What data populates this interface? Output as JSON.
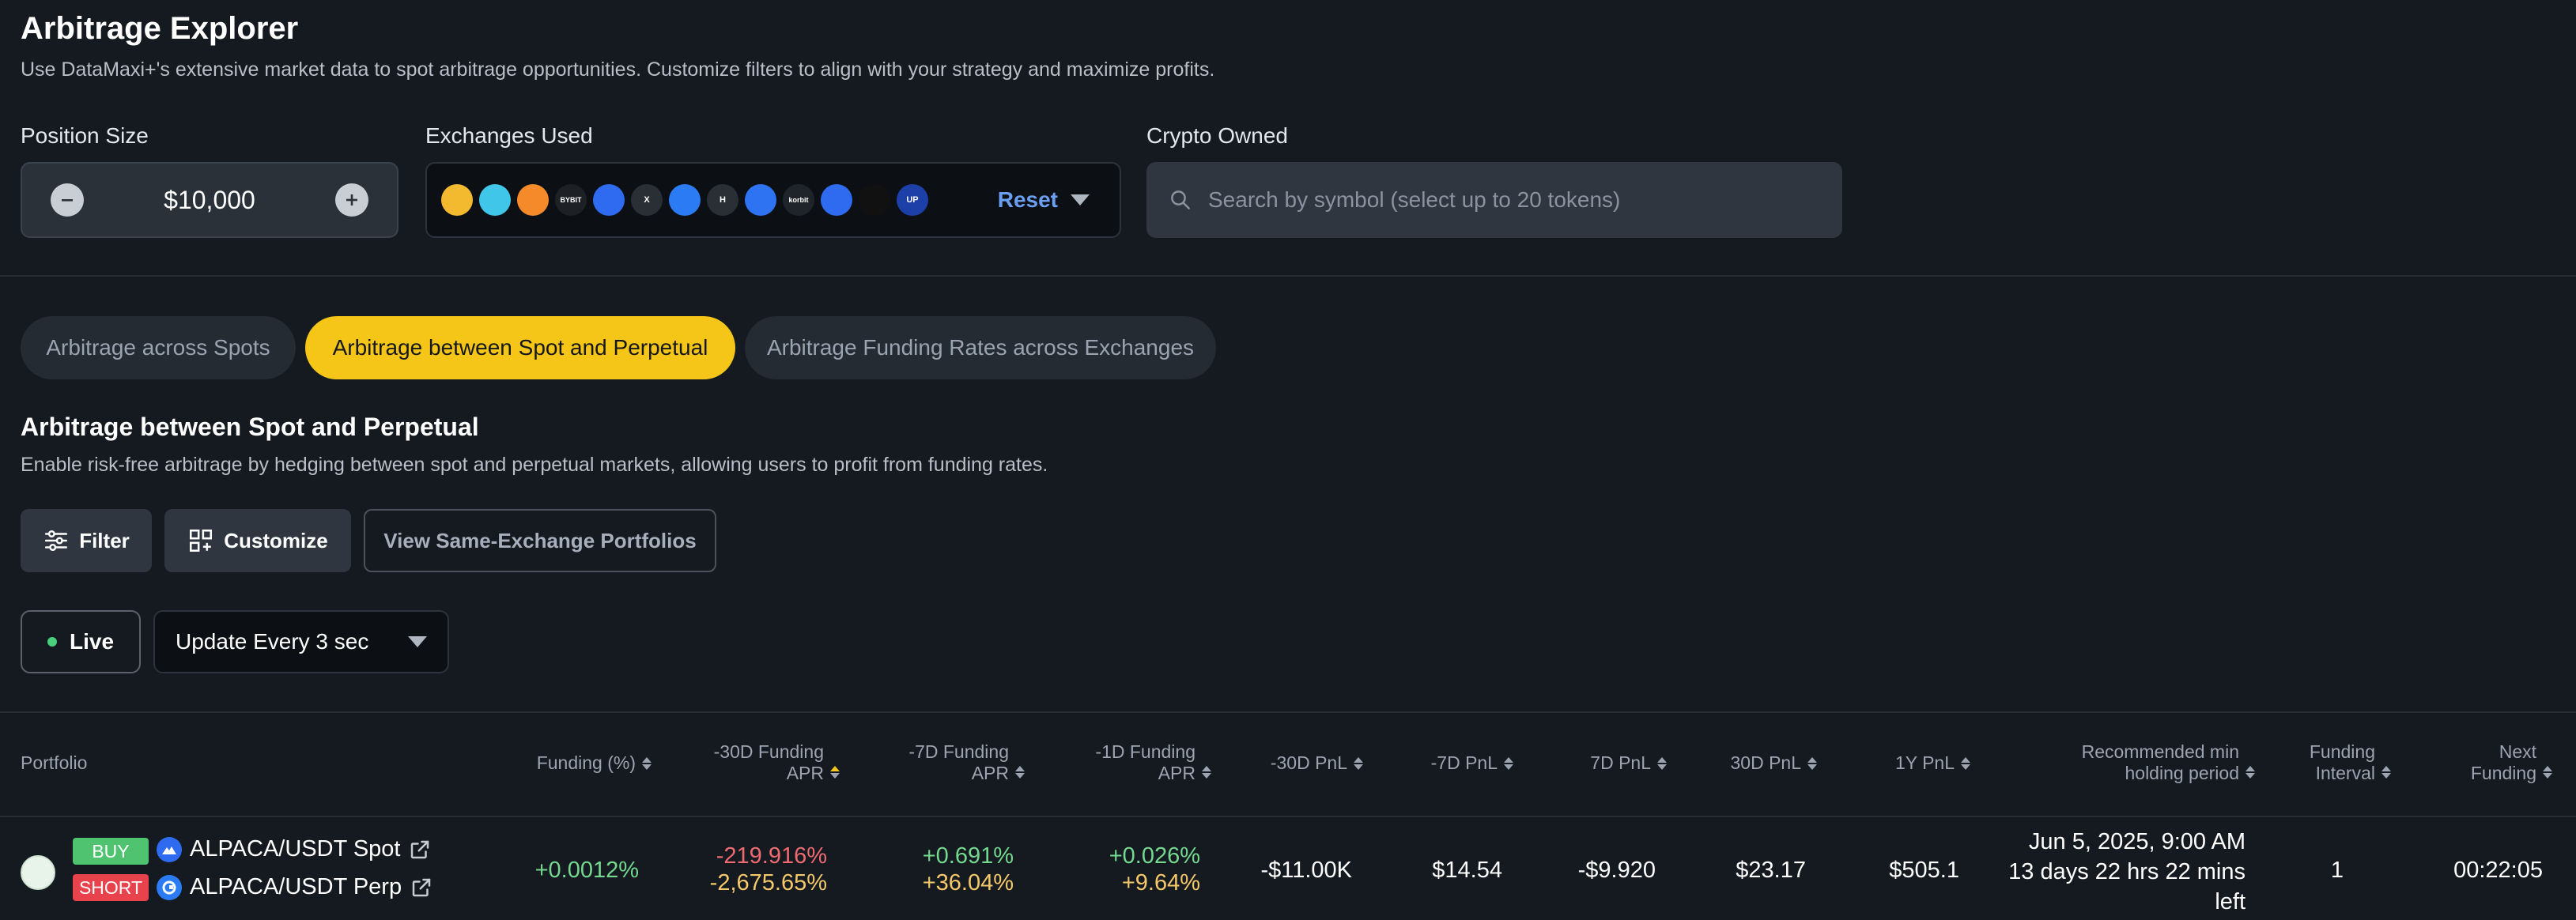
{
  "page": {
    "title": "Arbitrage Explorer",
    "subtitle": "Use DataMaxi+'s extensive market data to spot arbitrage opportunities. Customize filters to align with your strategy and maximize profits."
  },
  "position_size": {
    "label": "Position Size",
    "value": "$10,000"
  },
  "exchanges": {
    "label": "Exchanges Used",
    "reset_label": "Reset",
    "items": [
      {
        "icon": "binance-icon",
        "text": "",
        "color": "#f3ba2f"
      },
      {
        "icon": "swap-exchange-icon",
        "text": "",
        "color": "#3fc6e8"
      },
      {
        "icon": "fox-exchange-icon",
        "text": "",
        "color": "#f48a2a"
      },
      {
        "icon": "bybit-icon",
        "text": "BYBIT",
        "color": "#1d2126"
      },
      {
        "icon": "coinbase-icon",
        "text": "",
        "color": "#2f6bf0"
      },
      {
        "icon": "x-exchange-icon",
        "text": "X",
        "color": "#2a2f36"
      },
      {
        "icon": "gate-icon",
        "text": "",
        "color": "#2b7cf4"
      },
      {
        "icon": "h-exchange-icon",
        "text": "H",
        "color": "#2a2f36"
      },
      {
        "icon": "flame-exchange-icon",
        "text": "",
        "color": "#2d73f2"
      },
      {
        "icon": "korbit-icon",
        "text": "korbit",
        "color": "#1f242b"
      },
      {
        "icon": "mountain-exchange-icon",
        "text": "",
        "color": "#2f6bf0"
      },
      {
        "icon": "okx-icon",
        "text": "",
        "color": "#111111"
      },
      {
        "icon": "upbit-icon",
        "text": "UP",
        "color": "#1d3fa8"
      }
    ]
  },
  "crypto_owned": {
    "label": "Crypto Owned",
    "placeholder": "Search by symbol (select up to 20 tokens)"
  },
  "tabs": [
    {
      "label": "Arbitrage across Spots"
    },
    {
      "label": "Arbitrage between Spot and Perpetual"
    },
    {
      "label": "Arbitrage Funding Rates across Exchanges"
    }
  ],
  "section": {
    "title": "Arbitrage between Spot and Perpetual",
    "description": "Enable risk-free arbitrage by hedging between spot and perpetual markets, allowing users to profit from funding rates."
  },
  "actions": {
    "filter_label": "Filter",
    "customize_label": "Customize",
    "same_exchange_label": "View Same-Exchange Portfolios"
  },
  "live": {
    "label": "Live",
    "update_label": "Update Every 3 sec"
  },
  "table": {
    "headers": {
      "portfolio": "Portfolio",
      "funding": "Funding (%)",
      "apr30_l1": "-30D Funding",
      "apr30_l2": "APR",
      "apr7_l1": "-7D Funding",
      "apr7_l2": "APR",
      "apr1_l1": "-1D Funding",
      "apr1_l2": "APR",
      "pnl_m30": "-30D PnL",
      "pnl_m7": "-7D PnL",
      "pnl_7": "7D PnL",
      "pnl_30": "30D PnL",
      "pnl_1y": "1Y PnL",
      "hold_l1": "Recommended min",
      "hold_l2": "holding period",
      "interval_l1": "Funding",
      "interval_l2": "Interval",
      "next_l1": "Next",
      "next_l2": "Funding"
    },
    "row": {
      "buy_tag": "BUY",
      "short_tag": "SHORT",
      "spot_pair": "ALPACA/USDT Spot",
      "perp_pair": "ALPACA/USDT Perp",
      "funding": "+0.0012%",
      "apr30_top": "-219.916%",
      "apr30_bottom": "-2,675.65%",
      "apr7_top": "+0.691%",
      "apr7_bottom": "+36.04%",
      "apr1_top": "+0.026%",
      "apr1_bottom": "+9.64%",
      "pnl_m30": "-$11.00K",
      "pnl_m7": "$14.54",
      "pnl_7": "-$9.920",
      "pnl_30": "$23.17",
      "pnl_1y": "$505.1",
      "hold_date": "Jun 5, 2025, 9:00 AM",
      "hold_left_1": "13 days 22 hrs 22 mins",
      "hold_left_2": "left",
      "interval": "1",
      "next_funding": "00:22:05"
    }
  },
  "colors": {
    "accent": "#f5c518",
    "positive": "#74d98e",
    "negative": "#f06a72",
    "link": "#6b9ff2",
    "background": "#151a20"
  }
}
